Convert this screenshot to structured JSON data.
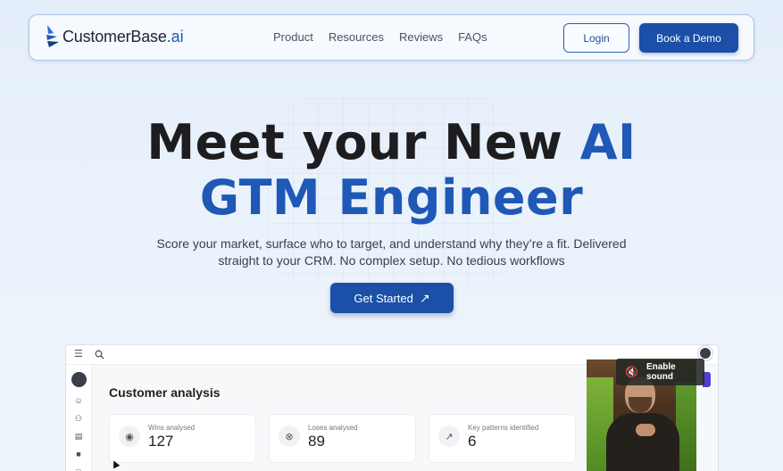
{
  "brand": {
    "name_main": "CustomerBase",
    "name_suffix": ".ai",
    "accent_color": "#1f58b6"
  },
  "nav": {
    "links": [
      "Product",
      "Resources",
      "Reviews",
      "FAQs"
    ],
    "login_label": "Login",
    "demo_label": "Book a Demo"
  },
  "hero": {
    "line1_text": "Meet your New",
    "line1_accent": "AI",
    "line2": "GTM Engineer",
    "subtitle_line1": "Score your market, surface who to target, and understand why they’re a fit. Delivered",
    "subtitle_line2": "straight to your CRM. No complex setup. No tedious workflows",
    "cta_label": "Get Started",
    "cta_icon": "arrow-up-right-icon"
  },
  "app_preview": {
    "title": "Customer analysis",
    "stats": [
      {
        "label": "Wins analysed",
        "value": "127",
        "icon": "award-icon"
      },
      {
        "label": "Loses analysed",
        "value": "89",
        "icon": "x-circle-icon"
      },
      {
        "label": "Key patterns identified",
        "value": "6",
        "icon": "trend-up-icon"
      }
    ],
    "sidebar_icons": [
      "user-circle-icon",
      "users-icon",
      "document-icon",
      "folder-filled-icon",
      "folder-icon"
    ]
  },
  "video": {
    "sound_label": "Enable sound",
    "sound_icon": "muted-speaker-icon"
  }
}
